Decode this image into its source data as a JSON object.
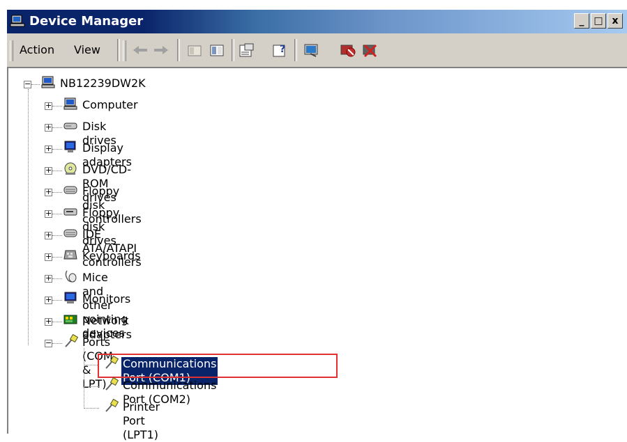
{
  "window": {
    "title": "Device Manager",
    "controls": {
      "minimize": "_",
      "maximize": "□",
      "close": "x"
    }
  },
  "toolbar": {
    "menu": [
      {
        "label": "Action",
        "accelerator": "A"
      },
      {
        "label": "View",
        "accelerator": "V"
      }
    ],
    "icons": [
      "back-arrow-icon",
      "forward-arrow-icon",
      "up-folder-icon",
      "show-hide-tree-icon",
      "properties-icon",
      "help-icon",
      "scan-hardware-icon",
      "disable-device-icon",
      "uninstall-device-icon"
    ]
  },
  "tree": {
    "root": {
      "label": "NB12239DW2K",
      "expanded": true,
      "icon": "computer-icon"
    },
    "categories": [
      {
        "label": "Computer",
        "icon": "computer-icon",
        "expanded": false
      },
      {
        "label": "Disk drives",
        "icon": "disk-drive-icon",
        "expanded": false
      },
      {
        "label": "Display adapters",
        "icon": "display-adapter-icon",
        "expanded": false
      },
      {
        "label": "DVD/CD-ROM drives",
        "icon": "dvd-drive-icon",
        "expanded": false
      },
      {
        "label": "Floppy disk controllers",
        "icon": "controller-icon",
        "expanded": false
      },
      {
        "label": "Floppy disk drives",
        "icon": "floppy-drive-icon",
        "expanded": false
      },
      {
        "label": "IDE ATA/ATAPI controllers",
        "icon": "controller-icon",
        "expanded": false
      },
      {
        "label": "Keyboards",
        "icon": "keyboard-icon",
        "expanded": false
      },
      {
        "label": "Mice and other pointing devices",
        "icon": "mouse-icon",
        "expanded": false
      },
      {
        "label": "Monitors",
        "icon": "monitor-icon",
        "expanded": false
      },
      {
        "label": "Network adapters",
        "icon": "network-adapter-icon",
        "expanded": false
      },
      {
        "label": "Ports (COM & LPT)",
        "icon": "port-icon",
        "expanded": true
      }
    ],
    "ports_children": [
      {
        "label": "Communications Port (COM1)",
        "icon": "port-icon",
        "selected": true
      },
      {
        "label": "Communications Port (COM2)",
        "icon": "port-icon",
        "selected": false
      },
      {
        "label": "Printer Port (LPT1)",
        "icon": "port-icon",
        "selected": false
      }
    ]
  },
  "colors": {
    "title_bar_start": "#0a246a",
    "selection": "#0a246a",
    "highlight_box": "#e03030",
    "chrome": "#d4d0c8"
  }
}
